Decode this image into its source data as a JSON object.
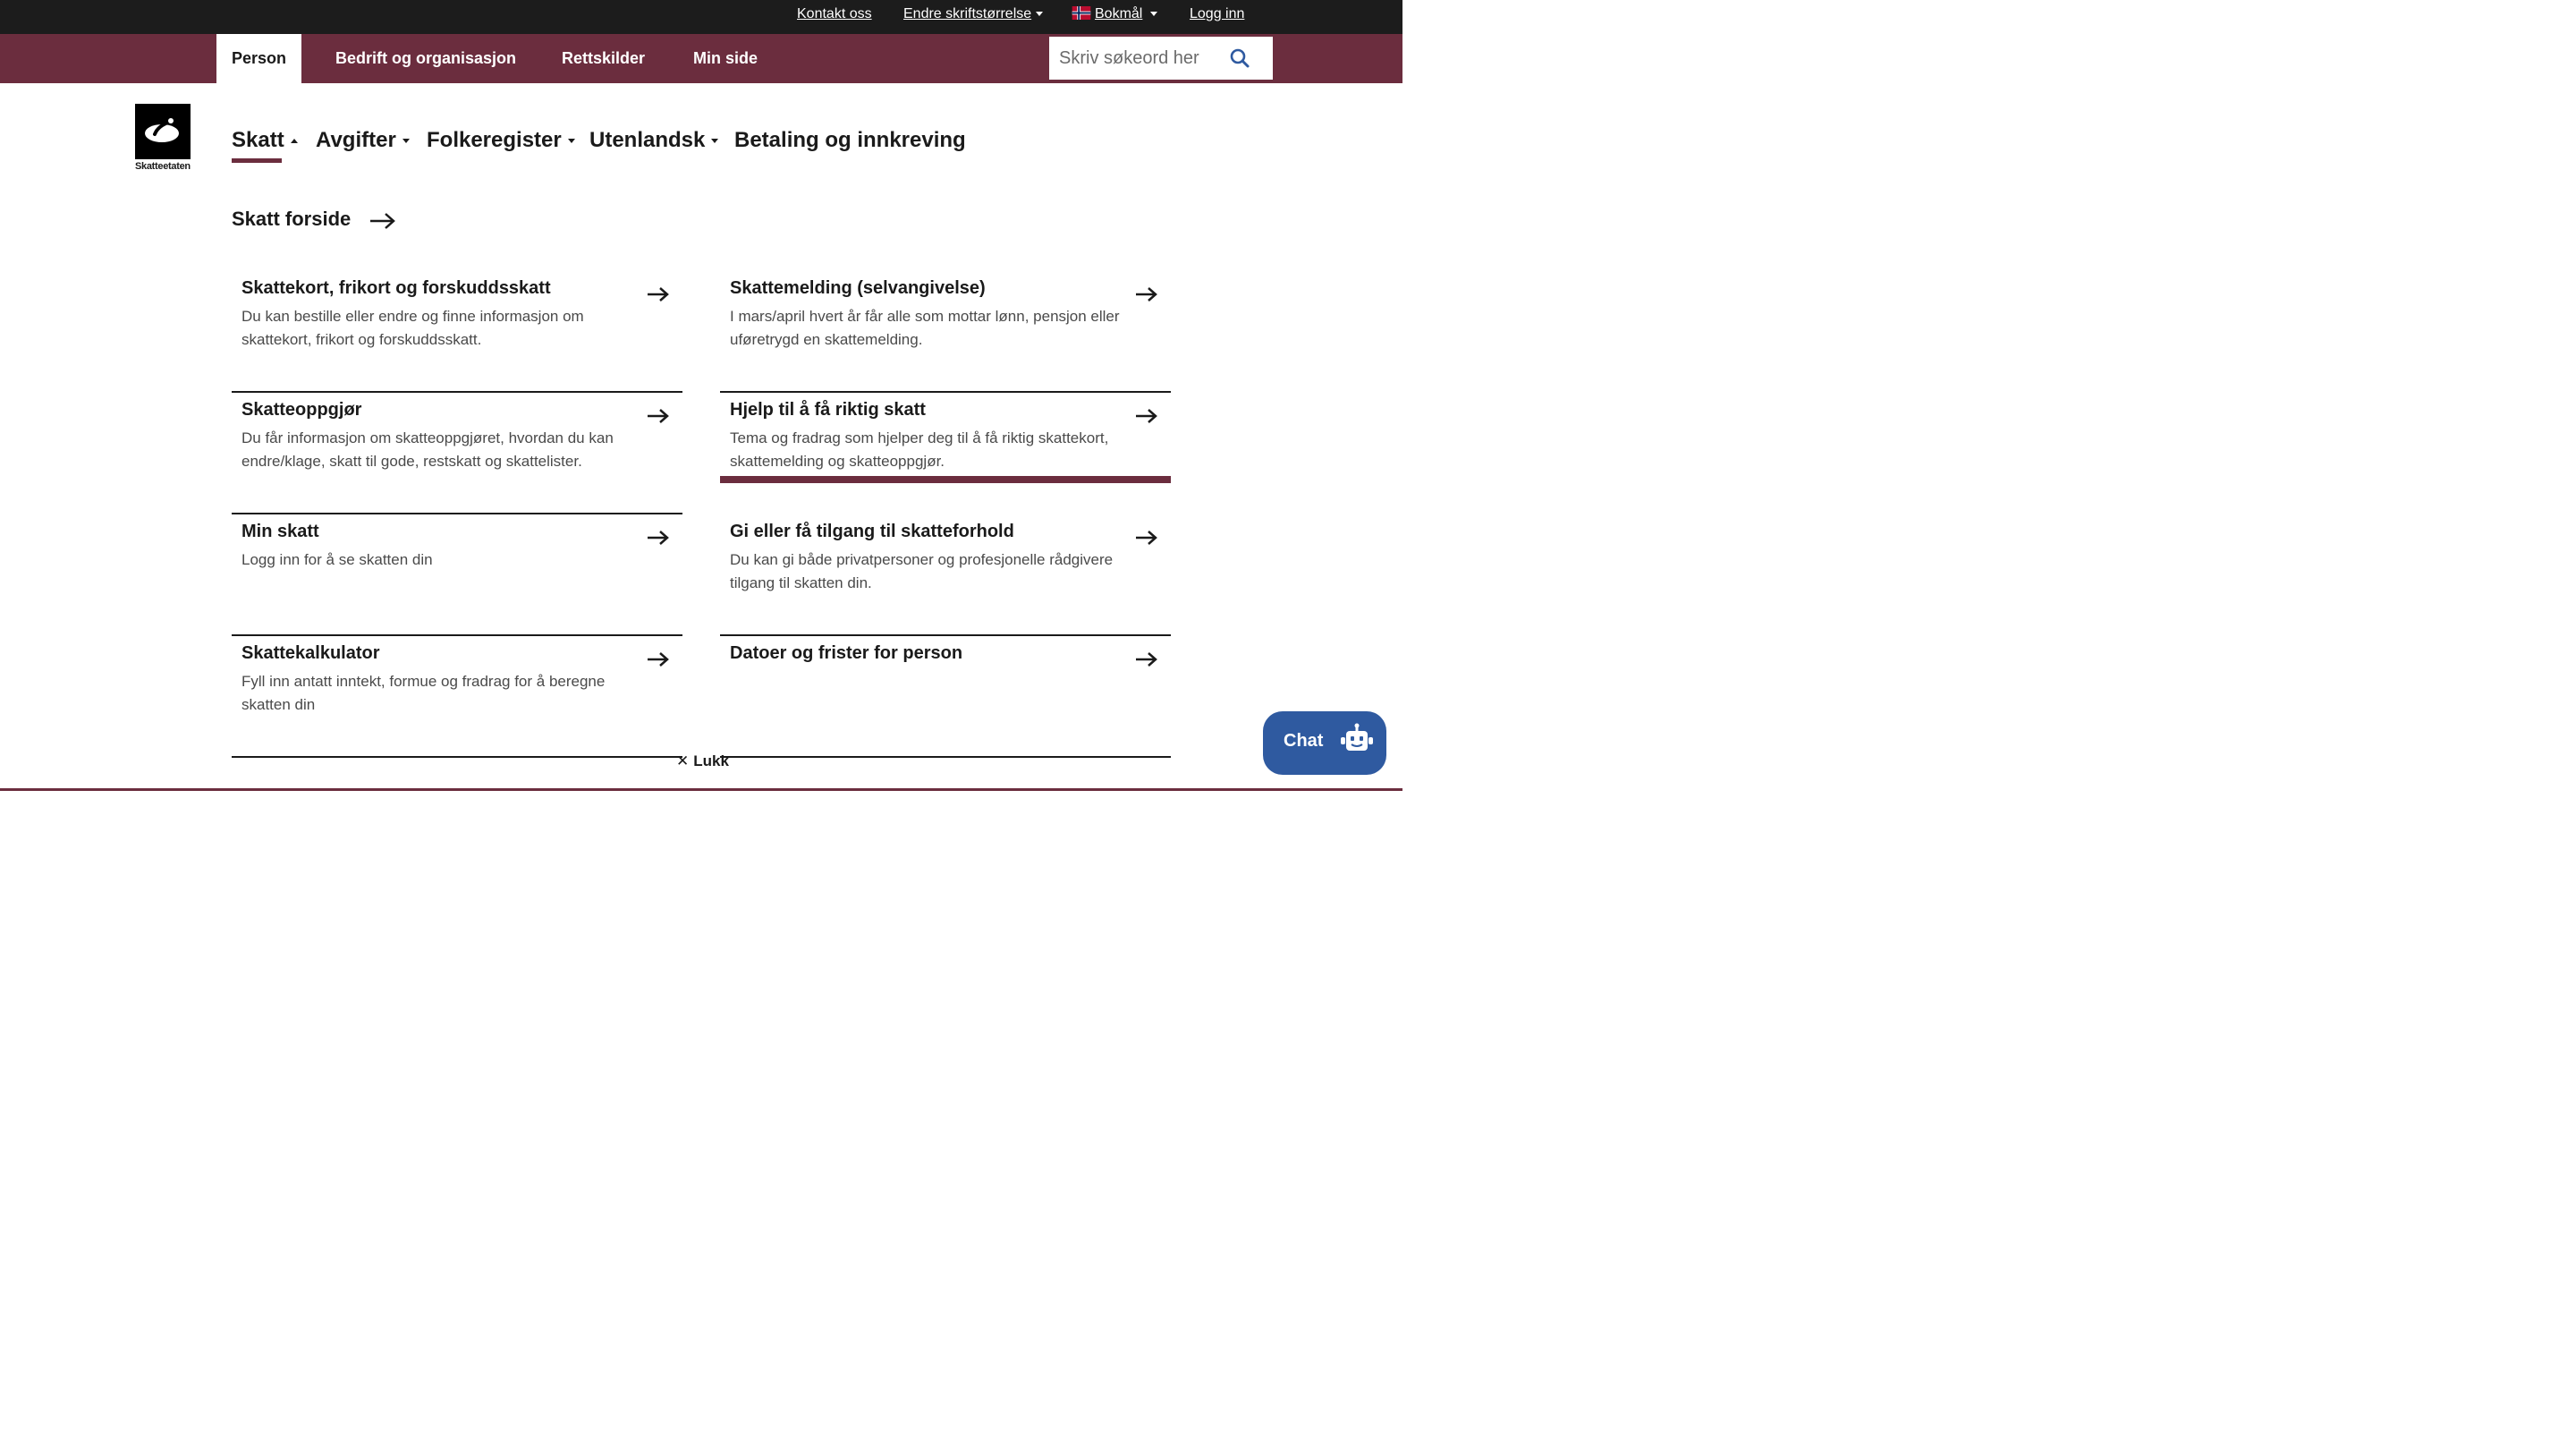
{
  "utility": {
    "contact": "Kontakt oss",
    "font_size": "Endre skriftstørrelse",
    "language": "Bokmål",
    "login": "Logg inn"
  },
  "nav": {
    "tabs": [
      "Person",
      "Bedrift og organisasjon",
      "Rettskilder",
      "Min side"
    ],
    "active_tab": "Person",
    "search_placeholder": "Skriv søkeord her"
  },
  "logo": {
    "text": "Skatteetaten"
  },
  "subnav": {
    "items": [
      "Skatt",
      "Avgifter",
      "Folkeregister",
      "Utenlandsk",
      "Betaling og innkreving"
    ],
    "active": "Skatt"
  },
  "section": {
    "heading": "Skatt forside"
  },
  "cards": [
    {
      "title": "Skattekort, frikort og forskuddsskatt",
      "desc": "Du kan bestille eller endre og finne informasjon om skattekort, frikort og forskuddsskatt."
    },
    {
      "title": "Skattemelding (selvangivelse)",
      "desc": "I mars/april hvert år får alle som mottar lønn, pensjon eller uføretrygd en skattemelding."
    },
    {
      "title": "Skatteoppgjør",
      "desc": "Du får informasjon om skatteoppgjøret, hvordan du kan endre/klage, skatt til gode, restskatt og skattelister."
    },
    {
      "title": "Hjelp til å få riktig skatt",
      "desc": "Tema og fradrag som hjelper deg til å få riktig skattekort, skattemelding og skatteoppgjør."
    },
    {
      "title": "Min skatt",
      "desc": "Logg inn for å se skatten din"
    },
    {
      "title": "Gi eller få tilgang til skatteforhold",
      "desc": "Du kan gi både privatpersoner og profesjonelle rådgivere tilgang til skatten din."
    },
    {
      "title": "Skattekalkulator",
      "desc": "Fyll inn antatt inntekt, formue og fradrag for å beregne skatten din"
    },
    {
      "title": "Datoer og frister for person",
      "desc": ""
    }
  ],
  "close": {
    "label": "Lukk"
  },
  "chat": {
    "label": "Chat"
  },
  "colors": {
    "brand": "#6b2d3e",
    "utility_bar": "#1c1c1c",
    "chat": "#2f5aa0"
  }
}
